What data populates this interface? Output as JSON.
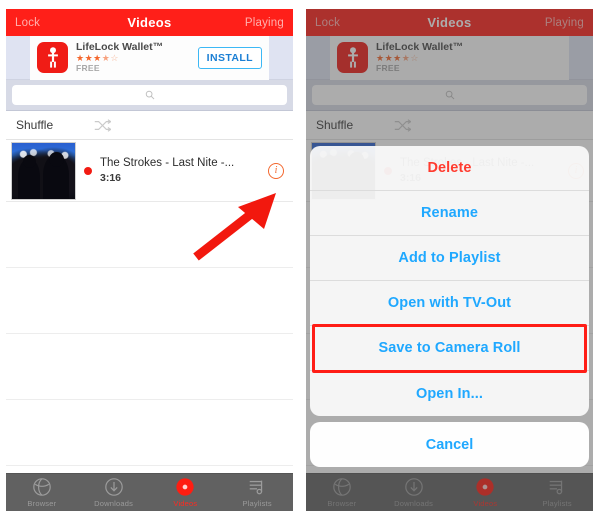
{
  "app": {
    "navbar": {
      "left_label": "Lock",
      "title": "Videos",
      "right_label": "Playing"
    },
    "ad": {
      "title": "LifeLock Wallet™",
      "price_label": "FREE",
      "install_label": "INSTALL",
      "rating_stars": "★★★★☆",
      "rating_value": "4.5",
      "icon_name": "lifelock-app-icon"
    },
    "search": {
      "placeholder": "",
      "value": "",
      "icon_name": "search-icon"
    },
    "shuffle": {
      "label": "Shuffle",
      "icon_name": "shuffle-icon"
    },
    "video_row": {
      "title": "The Strokes - Last Nite -...",
      "duration": "3:16",
      "info_glyph": "i",
      "status_dot_color": "#f21b12",
      "thumbnail_name": "concert-thumbnail"
    },
    "empty_rows": [
      "",
      "",
      "",
      ""
    ],
    "tabbar": {
      "tabs": [
        {
          "label": "Browser",
          "icon": "globe-icon",
          "active": false
        },
        {
          "label": "Downloads",
          "icon": "download-icon",
          "active": false
        },
        {
          "label": "Videos",
          "icon": "video-disc-icon",
          "active": true
        },
        {
          "label": "Playlists",
          "icon": "playlist-icon",
          "active": false
        }
      ],
      "active_color": "#ff2a20",
      "inactive_color": "#9a9a9a",
      "background": "#616161"
    }
  },
  "action_sheet": {
    "items": [
      {
        "label": "Delete",
        "style": "destructive"
      },
      {
        "label": "Rename",
        "style": "default"
      },
      {
        "label": "Add to Playlist",
        "style": "default"
      },
      {
        "label": "Open with TV-Out",
        "style": "default"
      },
      {
        "label": "Save to Camera Roll",
        "style": "default",
        "highlighted": true
      },
      {
        "label": "Open In...",
        "style": "default"
      }
    ],
    "cancel_label": "Cancel",
    "highlight_color": "#ff1d16",
    "tint_color": "#1fa8ff",
    "destructive_color": "#ff3b2f"
  },
  "annotations": {
    "arrow_color": "#f2180e",
    "arrow_target": "info-icon"
  },
  "theme": {
    "navbar_color": "#ff1f19",
    "ad_background": "#dfe3f2",
    "search_background": "#d7dae6"
  }
}
